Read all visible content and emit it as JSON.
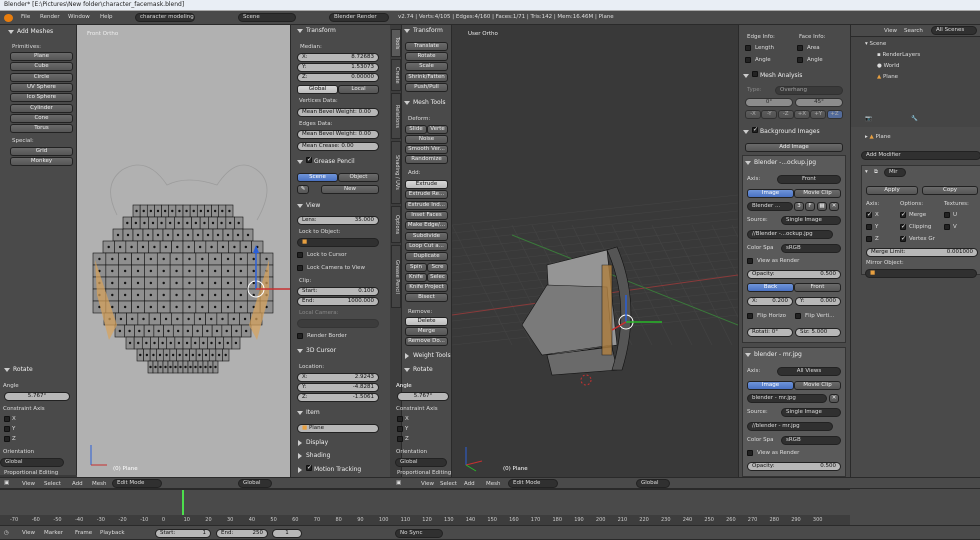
{
  "title": "Blender* [E:\\Pictures\\New folder\\character_facemask.blend]",
  "menu": [
    "File",
    "Render",
    "Window",
    "Help"
  ],
  "screen_layout": "character modeling",
  "scene_name": "Scene",
  "render_engine": "Blender Render",
  "stats": "v2.74 | Verts:4/105 | Edges:4/160 | Faces:1/71 | Tris:142 | Mem:16.46M | Plane",
  "left_tools": {
    "header": "Add Meshes",
    "primitives_label": "Primitives:",
    "primitives": [
      "Plane",
      "Cube",
      "Circle",
      "UV Sphere",
      "Ico Sphere",
      "Cylinder",
      "Cone",
      "Torus"
    ],
    "special_label": "Special:",
    "special": [
      "Grid",
      "Monkey"
    ],
    "rotate_header": "Rotate",
    "angle_label": "Angle",
    "angle_value": "5.767°",
    "constraint_label": "Constraint Axis",
    "axes": [
      "X",
      "Y",
      "Z"
    ],
    "orientation_label": "Orientation",
    "orientation_value": "Global",
    "proportional": "Proportional Editing"
  },
  "left_view": {
    "label": "Front Ortho",
    "object": "(0) Plane"
  },
  "props": {
    "transform": "Transform",
    "median": "Median:",
    "x": "8.72683",
    "y": "1.53073",
    "z": "0.00000",
    "global": "Global",
    "local": "Local",
    "vdata": "Vertices Data:",
    "mean_bevel_vert": "Mean Bevel Weight:  0.00",
    "edata": "Edges Data:",
    "mean_bevel_edge": "Mean Bevel Weight:  0.00",
    "mean_crease": "Mean Crease:        0.00",
    "grease_pencil": "Grease Pencil",
    "scene_btn": "Scene",
    "object_btn": "Object",
    "new_btn": "New",
    "view": "View",
    "lens": "Lens:",
    "lens_val": "35.000",
    "lock_to_object": "Lock to Object:",
    "lock_to_cursor": "Lock to Cursor",
    "lock_camera": "Lock Camera to View",
    "clip": "Clip:",
    "clip_start": "Start:",
    "clip_start_val": "0.100",
    "clip_end": "End:",
    "clip_end_val": "1000.000",
    "local_camera": "Local Camera:",
    "render_border": "Render Border",
    "cursor3d": "3D Cursor",
    "location": "Location:",
    "cx": "2.9243",
    "cy": "-4.8281",
    "cz": "-1.5061",
    "item": "Item",
    "item_name": "Plane",
    "display": "Display",
    "shading": "Shading",
    "motion": "Motion Tracking"
  },
  "mid_tabs": [
    "Tools",
    "Create",
    "Relations",
    "Shading / UVs",
    "Options",
    "Grease Pencil"
  ],
  "mid_tools": {
    "transform": "Transform",
    "items": [
      "Translate",
      "Rotate",
      "Scale",
      "Shrink/Fatten",
      "Push/Pull"
    ],
    "mesh_tools": "Mesh Tools",
    "deform": "Deform:",
    "slide": "Slide",
    "vertex": "Verte",
    "deform_items": [
      "Noise",
      "Smooth Ver...",
      "Randomize"
    ],
    "add": "Add:",
    "add_items": [
      "Extrude",
      "Extrude Re...",
      "Extrude Ind...",
      "Inset Faces",
      "Make Edge/...",
      "Subdivide",
      "Loop Cut a...",
      "Duplicate"
    ],
    "spin": "Spin",
    "screw": "Scre",
    "knife": "Knife",
    "select": "Selec",
    "knife_project": "Knife Project",
    "bisect": "Bisect",
    "remove": "Remove:",
    "remove_items": [
      "Delete",
      "Merge",
      "Remove Do..."
    ],
    "weight_tools": "Weight Tools",
    "rotate_header": "Rotate",
    "angle_label": "Angle",
    "angle_value": "5.767°",
    "constraint_label": "Constraint Axis",
    "axes": [
      "X",
      "Y",
      "Z"
    ],
    "orientation_label": "Orientation",
    "orientation_value": "Global",
    "proportional": "Proportional Editing"
  },
  "right_view": {
    "label": "User Ortho",
    "object": "(0) Plane"
  },
  "bg_panel": {
    "edge_info": "Edge Info:",
    "face_info": "Face Info:",
    "length": "Length",
    "area": "Area",
    "angle": "Angle",
    "angle2": "Angle",
    "mesh_analysis": "Mesh Analysis",
    "type_label": "Type:",
    "type_val": "Overhang",
    "mesh_a": "0°",
    "mesh_b": "45°",
    "axis_btns": [
      "-X",
      "-Y",
      "-Z",
      "+X",
      "+Y",
      "+Z"
    ],
    "background_images": "Background Images",
    "add_image": "Add Image",
    "img1_name": "Blender -...ockup.jpg",
    "axis_label": "Axis:",
    "axis1": "Front",
    "image_btn": "Image",
    "movieclip_btn": "Movie Clip",
    "img1_field": "Blender ...",
    "img1_users": "3",
    "img1_f": "F",
    "source_label": "Source:",
    "source_val": "Single Image",
    "img1_path": "//Blender -...ockup.jpg",
    "color_spa": "Color Spa",
    "srgb": "sRGB",
    "view_as_render": "View as Render",
    "opacity_label": "Opacity:",
    "opacity_val": "0.500",
    "back_btn": "Back",
    "front_btn": "Front",
    "x_label": "X:",
    "x_val": "0.200",
    "y_label": "Y:",
    "y_val": "0.000",
    "flip_h": "Flip Horizo",
    "flip_v": "Flip Verti...",
    "rotation": "Rotati: 0°",
    "size": "Siz: 5.000",
    "img2_name": "blender - mr.jpg",
    "axis2": "All Views",
    "img2_field": "blender - mr.jpg",
    "img2_path": "//blender - mr.jpg",
    "opacity2_val": "0.500"
  },
  "outliner": {
    "view": "View",
    "search": "Search",
    "all_scenes": "All Scenes",
    "scene": "Scene",
    "render_layers": "RenderLayers",
    "world": "World",
    "plane": "Plane"
  },
  "modifiers": {
    "object": "Plane",
    "add_modifier": "Add Modifier",
    "mir": "Mir",
    "apply": "Apply",
    "copy": "Copy",
    "axis": "Axis:",
    "options": "Options:",
    "textures": "Textures:",
    "x": "X",
    "y": "Y",
    "z": "Z",
    "merge": "Merge",
    "clipping": "Clipping",
    "vertex_gr": "Vertex Gr",
    "u": "U",
    "v": "V",
    "merge_limit": "Merge Limit:",
    "merge_limit_val": "0.001000",
    "mirror_object": "Mirror Object:"
  },
  "header3d": {
    "view": "View",
    "select": "Select",
    "add": "Add",
    "mesh": "Mesh",
    "mode": "Edit Mode",
    "global": "Global"
  },
  "timeline": {
    "ticks": [
      "-70",
      "-60",
      "-50",
      "-40",
      "-30",
      "-20",
      "-10",
      "0",
      "10",
      "20",
      "30",
      "40",
      "50",
      "60",
      "70",
      "80",
      "90",
      "100",
      "110",
      "120",
      "130",
      "140",
      "150",
      "160",
      "170",
      "180",
      "190",
      "200",
      "210",
      "220",
      "230",
      "240",
      "250",
      "260",
      "270",
      "280",
      "290",
      "300"
    ],
    "view": "View",
    "marker": "Marker",
    "frame": "Frame",
    "playback": "Playback",
    "start": "Start:",
    "start_val": "1",
    "end": "End:",
    "end_val": "250",
    "current": "1",
    "nosync": "No Sync"
  }
}
